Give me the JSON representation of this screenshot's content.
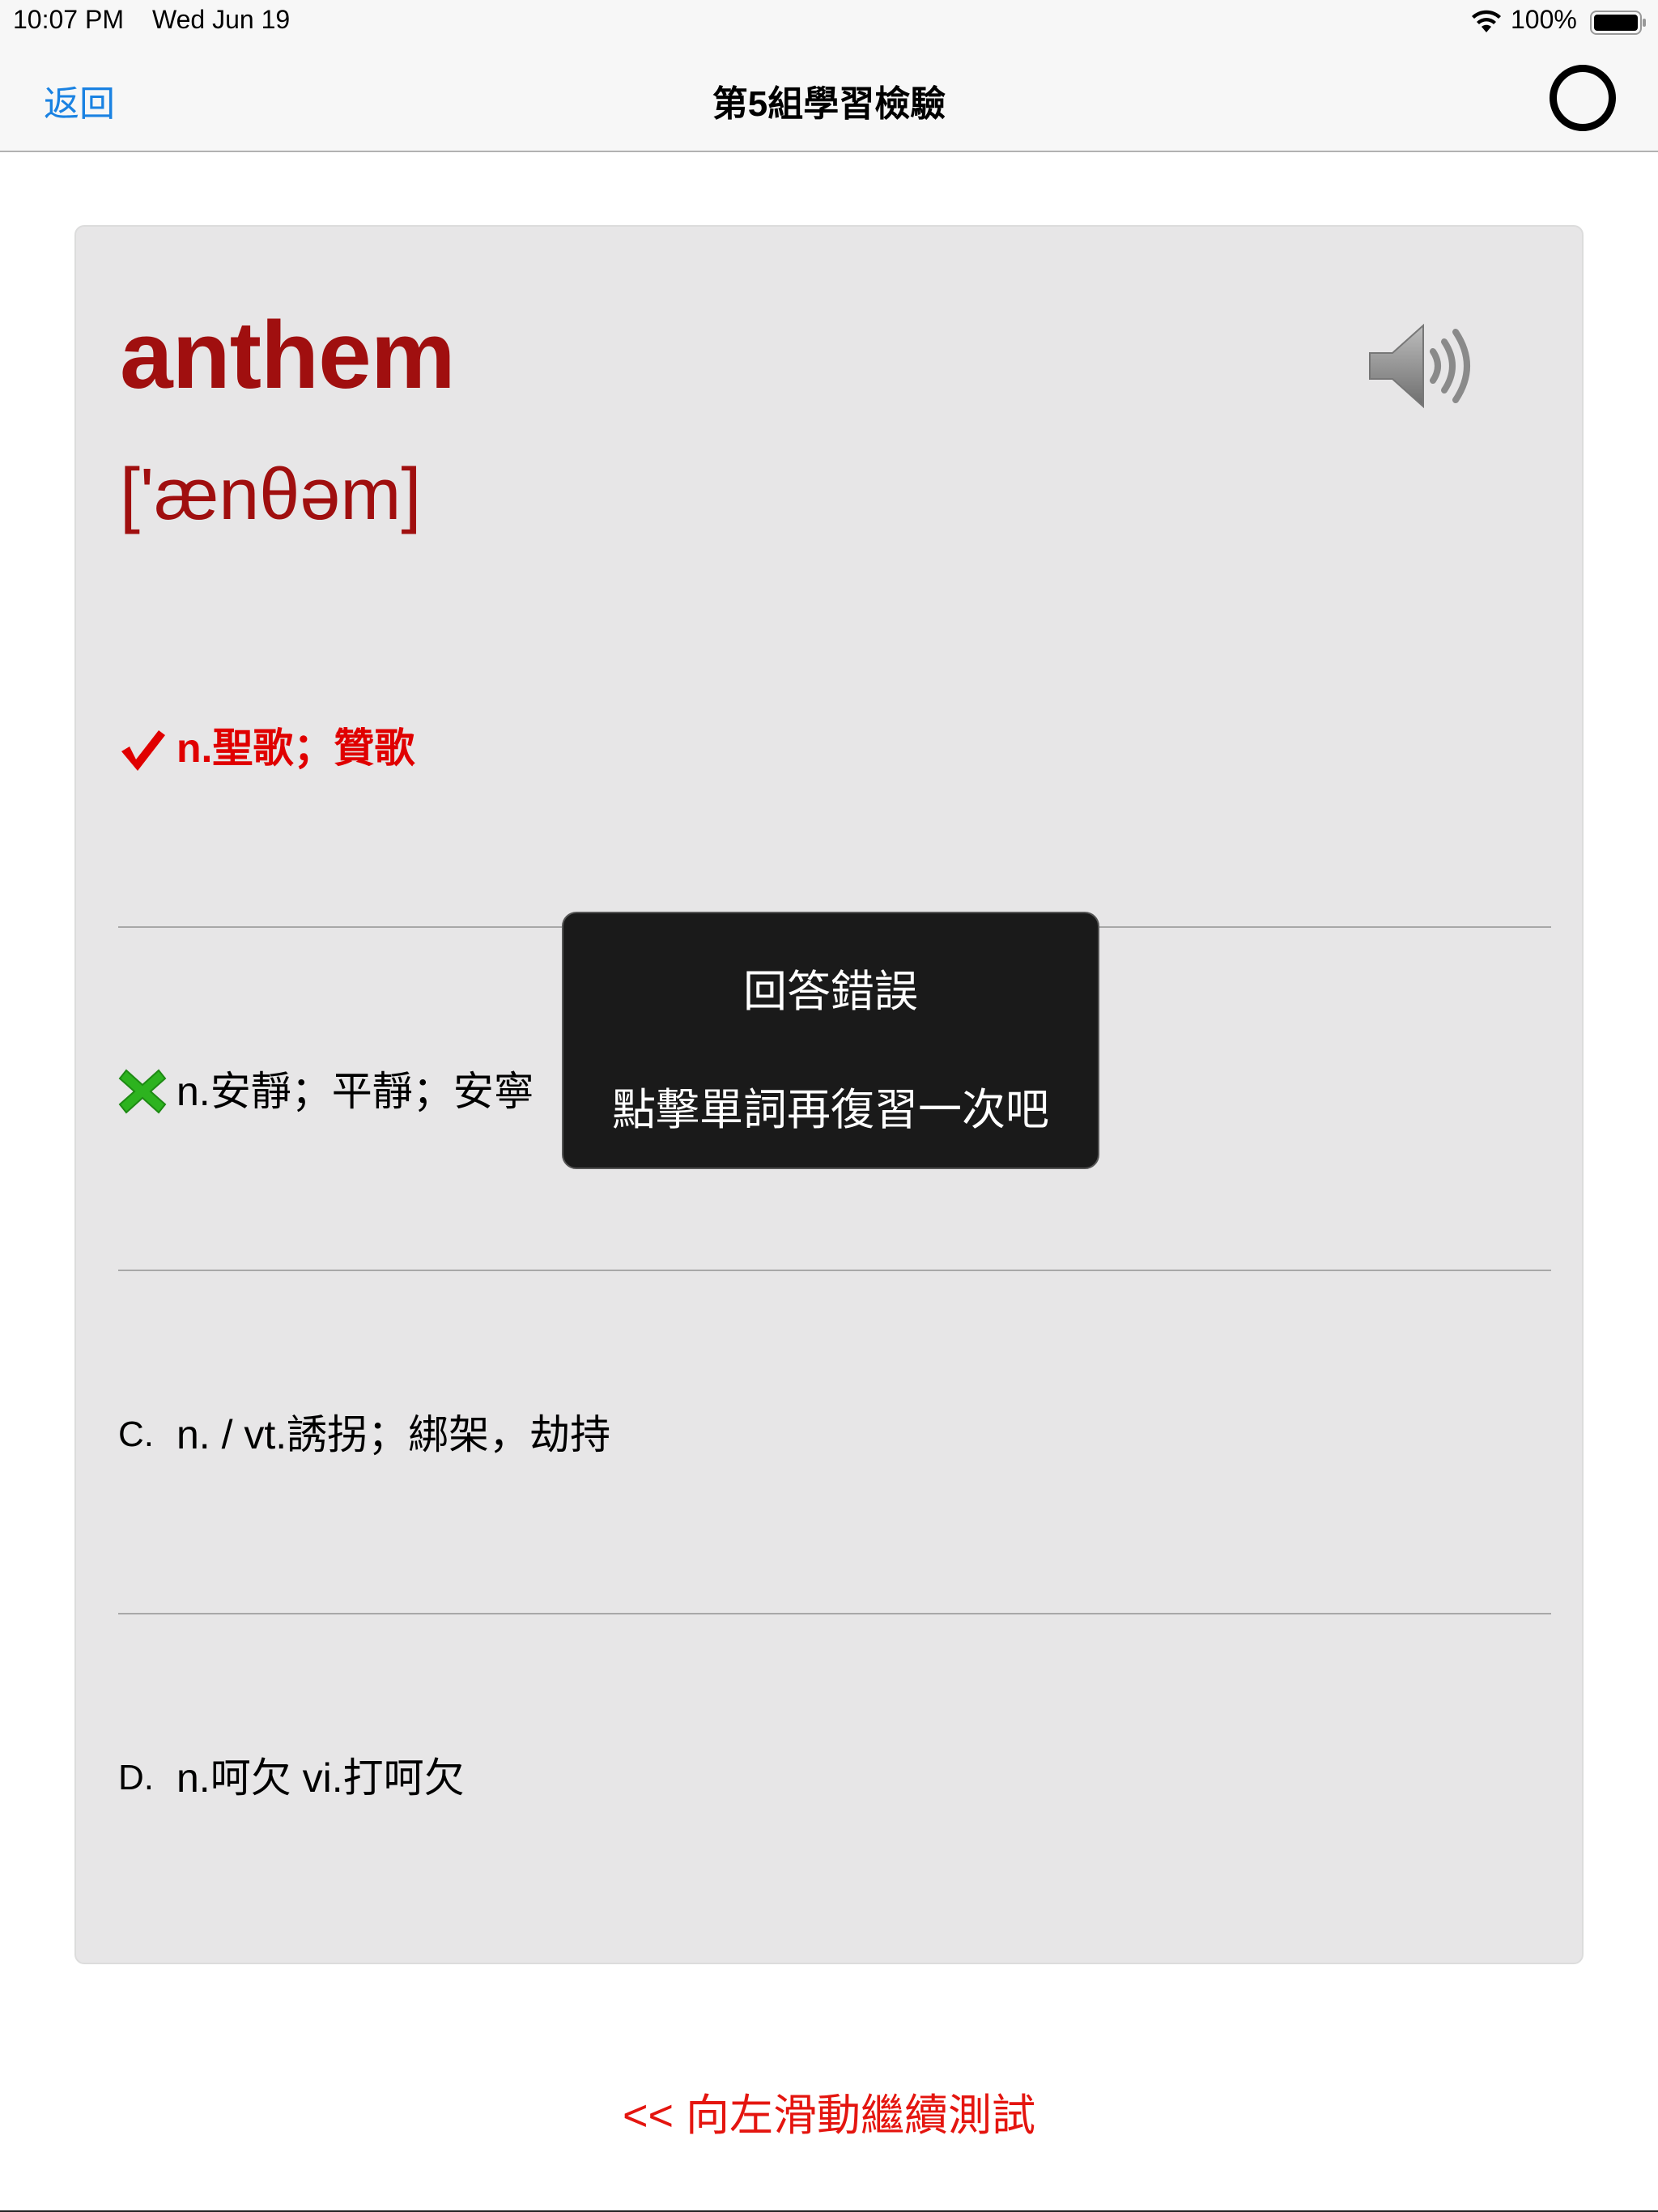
{
  "status_bar": {
    "time": "10:07 PM",
    "date": "Wed Jun 19",
    "battery": "100%"
  },
  "nav": {
    "back_label": "返回",
    "title": "第5組學習檢驗"
  },
  "card": {
    "word": "anthem",
    "phonetic": "['ænθəm]",
    "options": [
      {
        "marker": "✔",
        "marker_icon": "checkmark-icon",
        "text": "n.聖歌；贊歌",
        "state": "correct"
      },
      {
        "marker": "✖",
        "marker_icon": "cross-icon",
        "text": "n.安靜；平靜；安寧",
        "state": "wrong"
      },
      {
        "marker": "C.",
        "text": "n. / vt.誘拐；綁架，劫持"
      },
      {
        "marker": "D.",
        "text": "n.呵欠 vi.打呵欠"
      }
    ]
  },
  "toast": {
    "title": "回答錯誤",
    "message": "點擊單詞再復習一次吧"
  },
  "footer": {
    "swipe_hint": "<< 向左滑動繼續測試"
  },
  "colors": {
    "accent_blue": "#1a82e2",
    "word_red": "#a00f0f",
    "correct_red": "#e00000",
    "wrong_green": "#2db31f",
    "card_bg": "#e7e6e7"
  }
}
